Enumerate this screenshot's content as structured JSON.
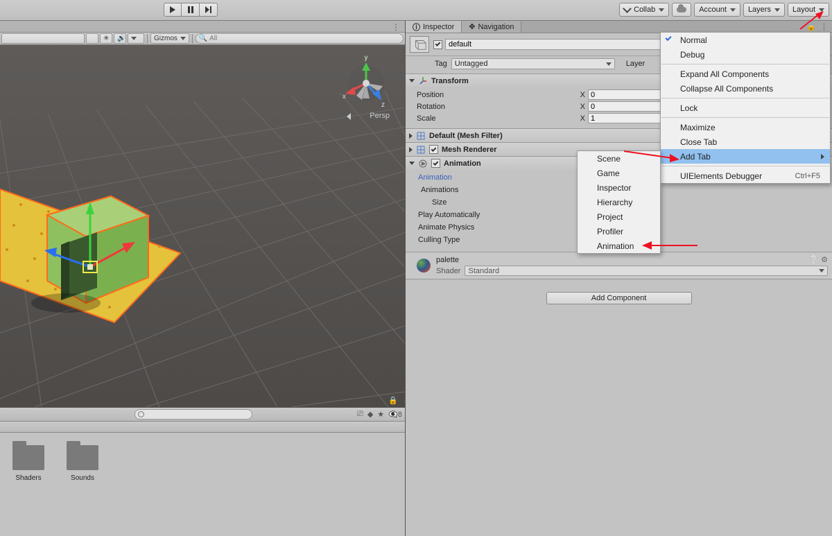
{
  "toolbar": {
    "collab": "Collab",
    "account": "Account",
    "layers": "Layers",
    "layout": "Layout"
  },
  "scene_toolbar": {
    "gizmos": "Gizmos",
    "search_placeholder": "All"
  },
  "persp": "Persp",
  "gizmo_axes": {
    "x": "x",
    "y": "y",
    "z": "z"
  },
  "inspector": {
    "tab_inspector": "Inspector",
    "tab_navigation": "Navigation",
    "object_name": "default",
    "tag_label": "Tag",
    "tag_value": "Untagged",
    "layer_label": "Layer",
    "transform": {
      "title": "Transform",
      "position": {
        "label": "Position",
        "x": "0"
      },
      "rotation": {
        "label": "Rotation",
        "x": "0"
      },
      "scale": {
        "label": "Scale",
        "x": "1"
      },
      "axis_x": "X"
    },
    "mesh_filter": {
      "title": "Default (Mesh Filter)"
    },
    "mesh_renderer": {
      "title": "Mesh Renderer"
    },
    "animation": {
      "title": "Animation",
      "link": "Animation",
      "animations": "Animations",
      "size": "Size",
      "play_auto": "Play Automatically",
      "animate_physics": "Animate Physics",
      "culling_type": "Culling Type"
    },
    "material": {
      "name": "palette",
      "shader_label": "Shader",
      "shader_value": "Standard"
    },
    "add_component": "Add Component"
  },
  "context_main": {
    "normal": "Normal",
    "debug": "Debug",
    "expand": "Expand All Components",
    "collapse": "Collapse All Components",
    "lock": "Lock",
    "maximize": "Maximize",
    "close_tab": "Close Tab",
    "add_tab": "Add Tab",
    "ui_debug": "UIElements Debugger",
    "ui_debug_sc": "Ctrl+F5"
  },
  "context_sub": {
    "scene": "Scene",
    "game": "Game",
    "inspector": "Inspector",
    "hierarchy": "Hierarchy",
    "project": "Project",
    "profiler": "Profiler",
    "animation": "Animation"
  },
  "assets": {
    "shaders": "Shaders",
    "sounds": "Sounds"
  },
  "hidden_count": "8"
}
